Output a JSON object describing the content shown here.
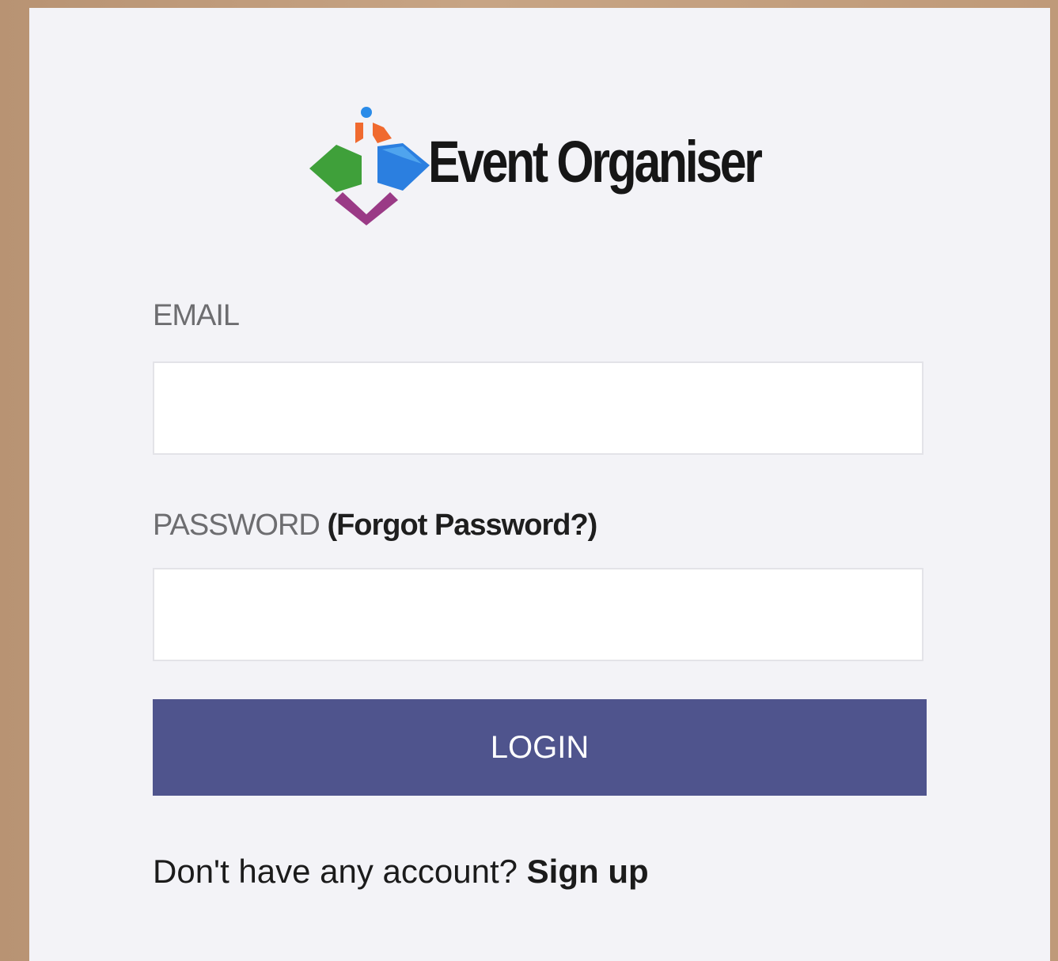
{
  "brand": {
    "name": "Event Organiser",
    "logo_icon": "diamond-cluster-logo-icon",
    "logo_colors": {
      "green": "#3fa03a",
      "blue": "#2b7fe0",
      "orange": "#f06a2f",
      "purple": "#9a3a86",
      "dot": "#2a8be8"
    }
  },
  "form": {
    "email_label": "EMAIL",
    "email_value": "",
    "password_label": "PASSWORD",
    "forgot_password_link": "(Forgot Password?)",
    "password_value": "",
    "login_button": "LOGIN",
    "signup_prompt": "Don't have any account?",
    "signup_link": "Sign up"
  },
  "colors": {
    "background": "#c09c7c",
    "card": "#f3f3f7",
    "button": "#4f548d",
    "button_text": "#ffffff"
  }
}
